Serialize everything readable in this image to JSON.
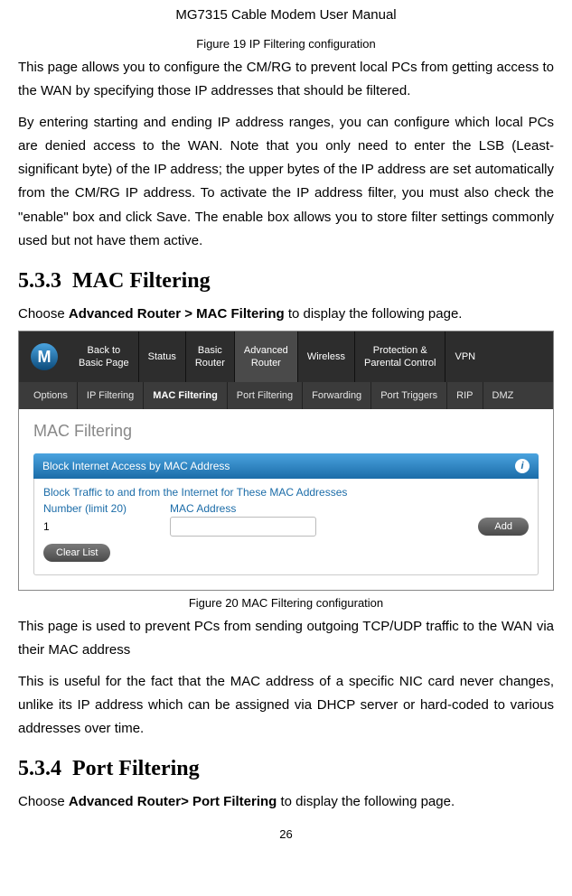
{
  "header": "MG7315 Cable Modem User Manual",
  "fig19_caption": "Figure 19 IP Filtering configuration",
  "para1": "This page allows you to configure the CM/RG to prevent local PCs from getting access to the WAN by specifying those IP addresses that should be filtered.",
  "para2": "By entering starting and ending IP address ranges, you can configure which local PCs are denied access to the WAN. Note that you only need to enter the LSB (Least-significant byte) of the IP address; the upper bytes of the IP address are set automatically from the CM/RG IP address. To activate the IP address filter, you must also check the \"enable\" box and click Save. The enable box allows you to store filter settings commonly used but not have them active.",
  "section533_num": "5.3.3",
  "section533_title": "MAC Filtering",
  "instruction533_pre": "Choose ",
  "instruction533_strong": "Advanced Router > MAC Filtering",
  "instruction533_post": " to display the following page.",
  "screenshot": {
    "logo_letter": "M",
    "topnav": [
      {
        "line1": "Back to",
        "line2": "Basic Page"
      },
      {
        "line1": "Status",
        "line2": ""
      },
      {
        "line1": "Basic",
        "line2": "Router"
      },
      {
        "line1": "Advanced",
        "line2": "Router",
        "active": true
      },
      {
        "line1": "Wireless",
        "line2": ""
      },
      {
        "line1": "Protection &",
        "line2": "Parental Control"
      },
      {
        "line1": "VPN",
        "line2": ""
      }
    ],
    "subnav": [
      "Options",
      "IP Filtering",
      "MAC Filtering",
      "Port Filtering",
      "Forwarding",
      "Port Triggers",
      "RIP",
      "DMZ"
    ],
    "subnav_active_index": 2,
    "page_title": "MAC Filtering",
    "bar_title": "Block Internet Access by MAC Address",
    "info_glyph": "i",
    "blue_link": "Block Traffic to and from the Internet for These MAC Addresses",
    "col1": "Number (limit 20)",
    "col2": "MAC Address",
    "row_number": "1",
    "add_btn": "Add",
    "clear_btn": "Clear List"
  },
  "fig20_caption": "Figure 20 MAC Filtering configuration",
  "para3": "This page is used to prevent PCs from sending outgoing TCP/UDP traffic to the WAN via their MAC address",
  "para4": "This is useful for the fact that the MAC address of a specific NIC card never changes, unlike its IP address which can be assigned via DHCP server or hard-coded to various addresses over time.",
  "section534_num": "5.3.4",
  "section534_title": "Port Filtering",
  "instruction534_pre": "Choose ",
  "instruction534_strong": "Advanced Router> Port Filtering",
  "instruction534_post": " to display the following page.",
  "page_number": "26"
}
